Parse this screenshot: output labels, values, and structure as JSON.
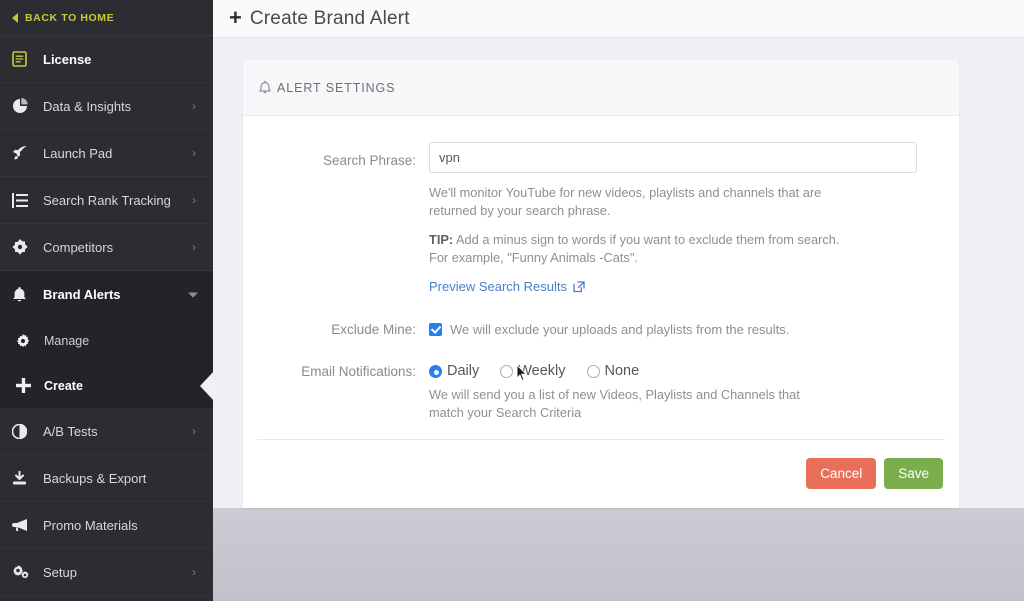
{
  "sidebar": {
    "back_home": {
      "label": "BACK TO HOME",
      "icon": "caret-left-icon",
      "color": "#c6c83c"
    },
    "items": [
      {
        "label": "License",
        "icon": "license-document-icon",
        "chevron": "",
        "state": "normal"
      },
      {
        "label": "Data & Insights",
        "icon": "pie-chart-icon",
        "chevron": "›",
        "state": "normal"
      },
      {
        "label": "Launch Pad",
        "icon": "rocket-icon",
        "chevron": "›",
        "state": "normal"
      },
      {
        "label": "Search Rank Tracking",
        "icon": "list-icon",
        "chevron": "›",
        "state": "normal"
      },
      {
        "label": "Competitors",
        "icon": "target-diamond-icon",
        "chevron": "›",
        "state": "normal"
      },
      {
        "label": "Brand Alerts",
        "icon": "bell-icon",
        "chevron": "⌄",
        "state": "expanded"
      }
    ],
    "brand_alerts_sub": [
      {
        "label": "Manage",
        "icon": "gear-icon",
        "active": false
      },
      {
        "label": "Create",
        "icon": "plus-icon",
        "active": true
      }
    ],
    "items_after": [
      {
        "label": "A/B Tests",
        "icon": "contrast-circle-icon",
        "chevron": "›"
      },
      {
        "label": "Backups & Export",
        "icon": "download-icon",
        "chevron": ""
      },
      {
        "label": "Promo Materials",
        "icon": "megaphone-icon",
        "chevron": ""
      },
      {
        "label": "Setup",
        "icon": "gears-icon",
        "chevron": "›"
      }
    ]
  },
  "topbar": {
    "plus": "+",
    "title": "Create Brand Alert"
  },
  "card": {
    "header": "ALERT SETTINGS",
    "header_icon": "bell-icon",
    "search_phrase": {
      "label": "Search Phrase:",
      "value": "vpn",
      "placeholder": "",
      "helper_1": "We'll monitor YouTube for new videos, playlists and channels that are returned by your search phrase.",
      "tip_label": "TIP:",
      "tip_text": " Add a minus sign to words if you want to exclude them from search. For example, \"Funny Animals -Cats\".",
      "preview_link": "Preview Search Results",
      "preview_link_icon": "external-link-icon"
    },
    "exclude_mine": {
      "label": "Exclude Mine:",
      "checked": true,
      "text": "We will exclude your uploads and playlists from the results."
    },
    "email_notifications": {
      "label": "Email Notifications:",
      "options": [
        {
          "label": "Daily",
          "selected": true
        },
        {
          "label": "Weekly",
          "selected": false
        },
        {
          "label": "None",
          "selected": false
        }
      ],
      "helper": "We will send you a list of new Videos, Playlists and Channels that match your Search Criteria"
    },
    "actions": {
      "cancel": "Cancel",
      "save": "Save"
    }
  },
  "colors": {
    "sidebar_bg": "#2b2d33",
    "sidebar_sub_bg": "#232429",
    "accent_yellow": "#c6c83c",
    "page_bg": "#eff0f5",
    "link_blue": "#4a7fc9",
    "checkbox_blue": "#2a7ef0",
    "cancel_red": "#e8705a",
    "save_green": "#7cad4c"
  }
}
